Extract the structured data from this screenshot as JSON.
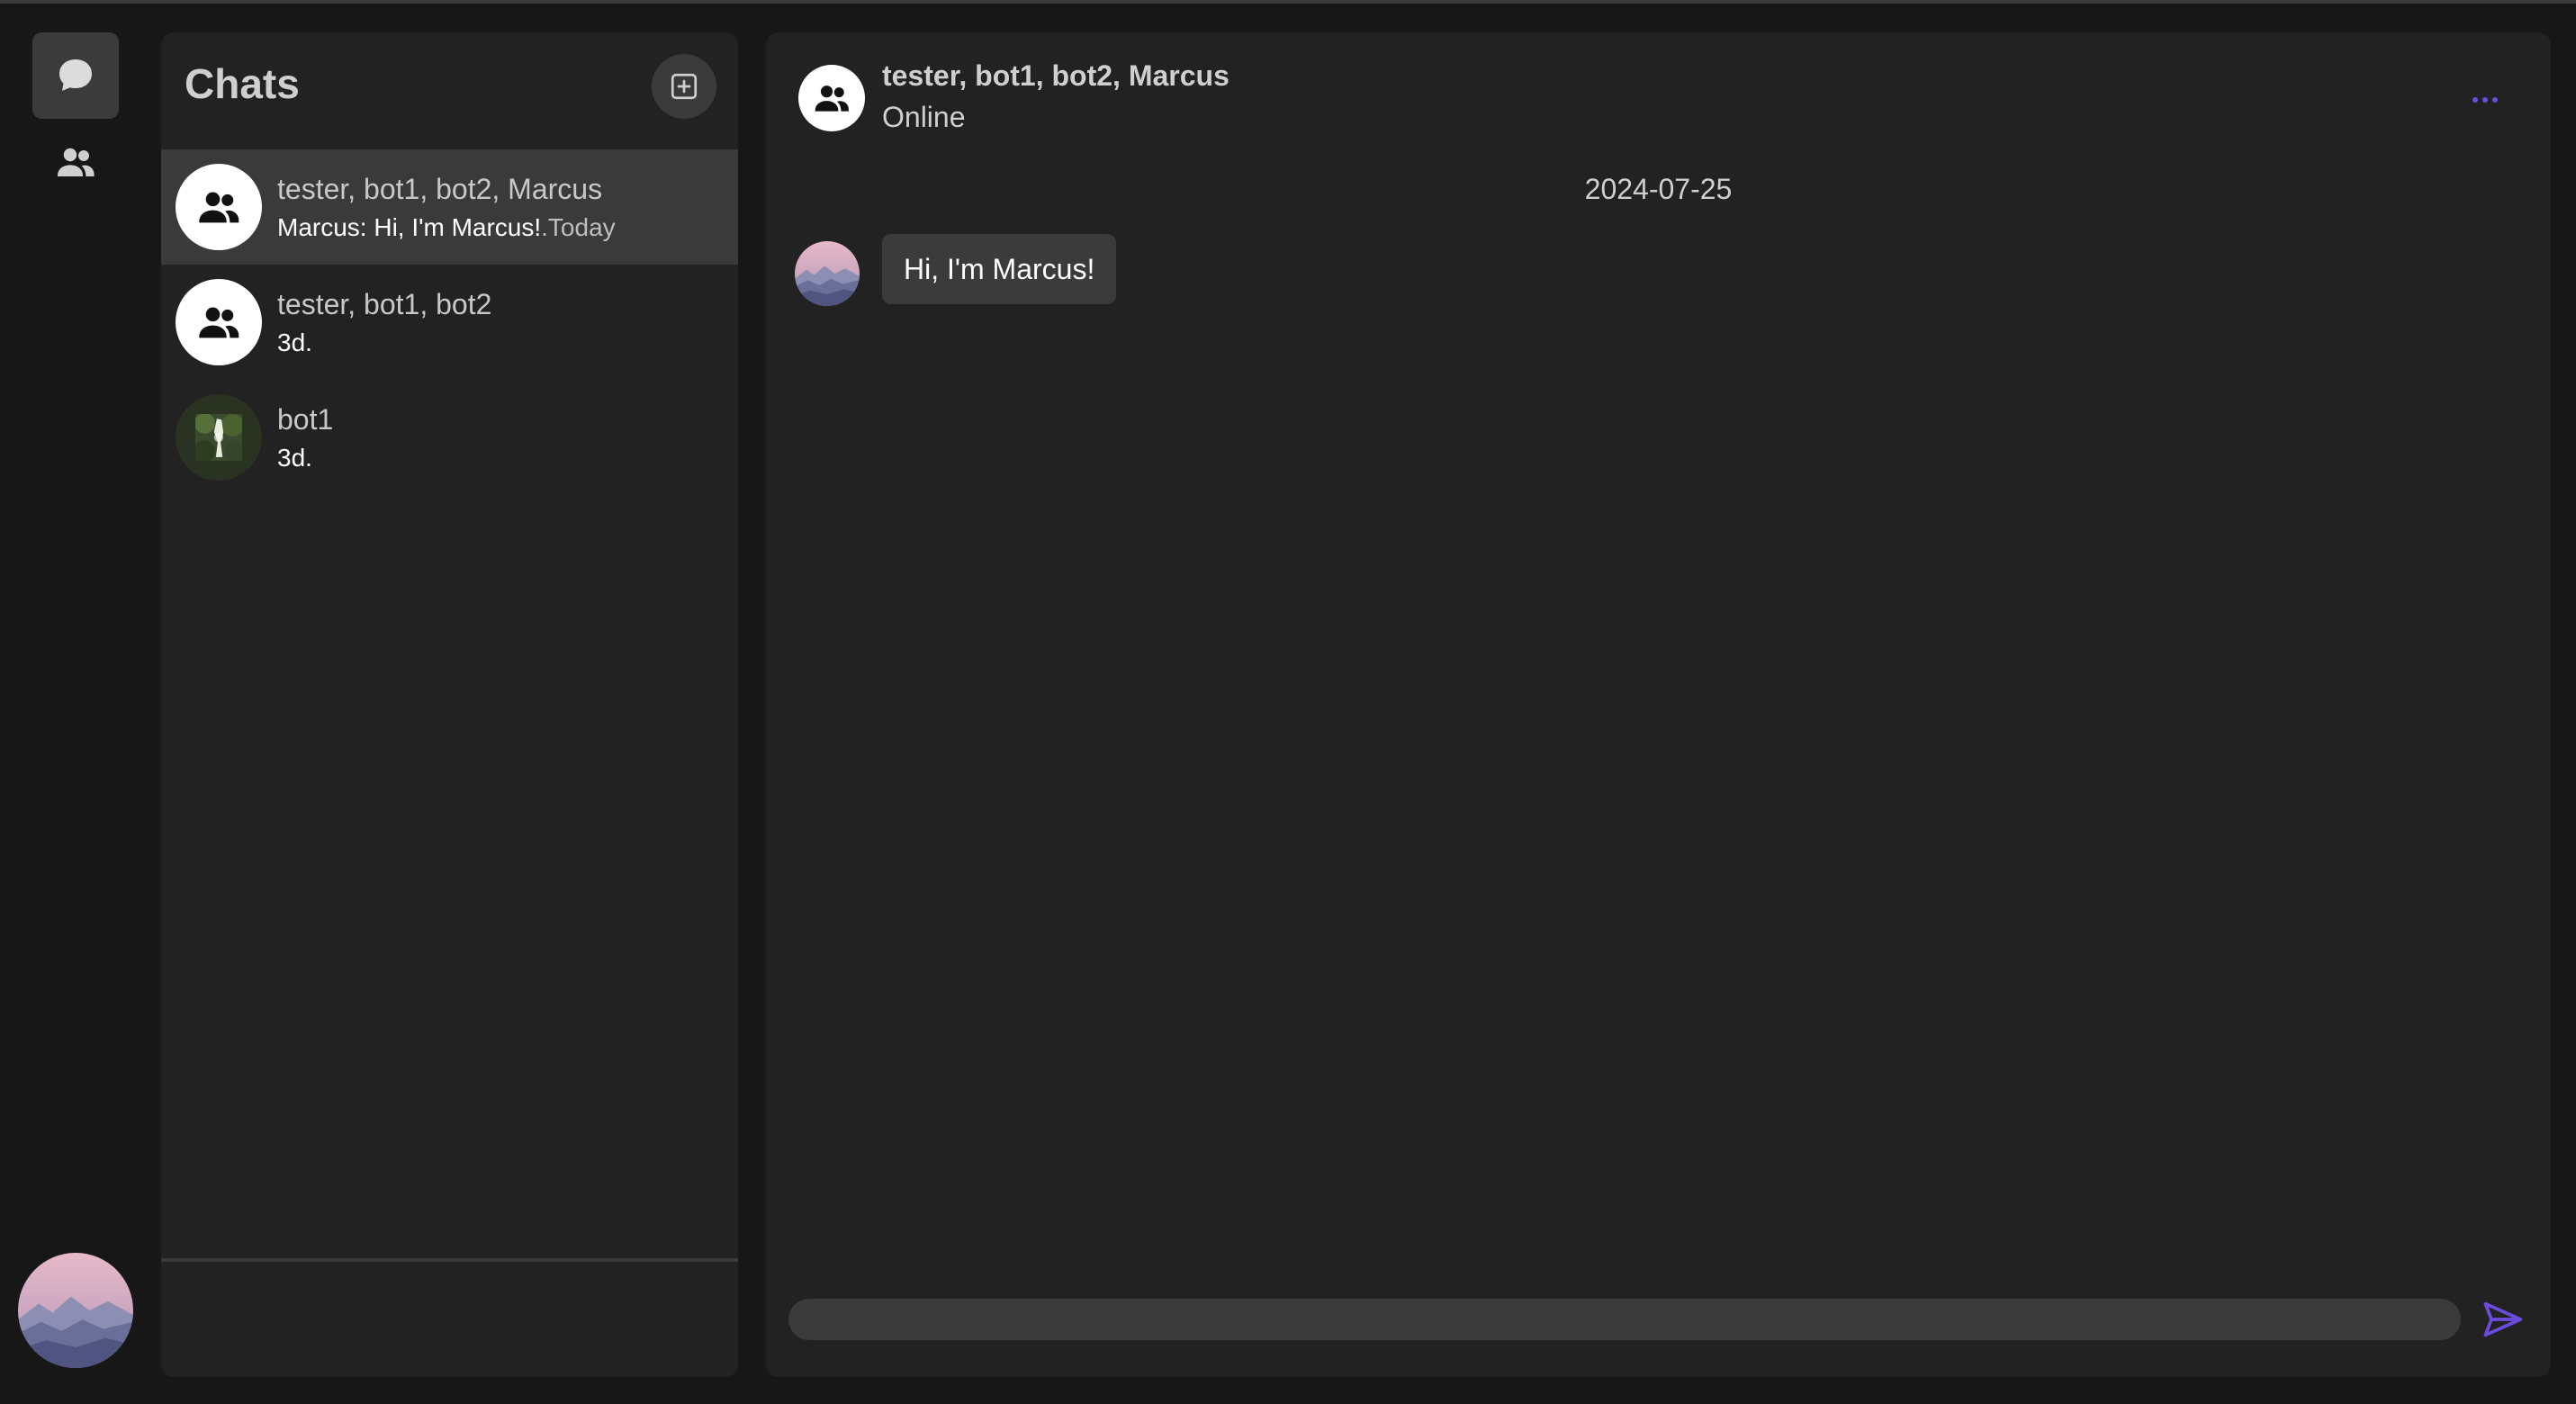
{
  "colors": {
    "accent": "#6c4ce0",
    "panel": "#222222",
    "background": "#171717",
    "bubble": "#3b3b3b"
  },
  "rail": {
    "items": [
      {
        "icon": "chat-bubble-icon",
        "active": true
      },
      {
        "icon": "users-icon",
        "active": false
      }
    ],
    "profile_avatar": "mountain-avatar"
  },
  "chats": {
    "title": "Chats",
    "new_chat_icon": "plus-square-icon",
    "items": [
      {
        "name": "tester, bot1, bot2, Marcus",
        "preview": "Marcus: Hi, I'm Marcus!",
        "time": ".Today",
        "avatar": "group-icon",
        "active": true
      },
      {
        "name": "tester, bot1, bot2",
        "preview": "",
        "time": "3d.",
        "avatar": "group-icon",
        "active": false
      },
      {
        "name": "bot1",
        "preview": "",
        "time": "3d.",
        "avatar": "forest-photo",
        "active": false
      }
    ]
  },
  "conversation": {
    "title": "tester, bot1, bot2, Marcus",
    "status": "Online",
    "date": "2024-07-25",
    "messages": [
      {
        "text": "Hi, I'm Marcus!",
        "avatar": "mountain-avatar"
      }
    ],
    "composer": {
      "value": "",
      "placeholder": ""
    },
    "send_icon": "send-icon",
    "more_icon": "more-dots-icon"
  }
}
